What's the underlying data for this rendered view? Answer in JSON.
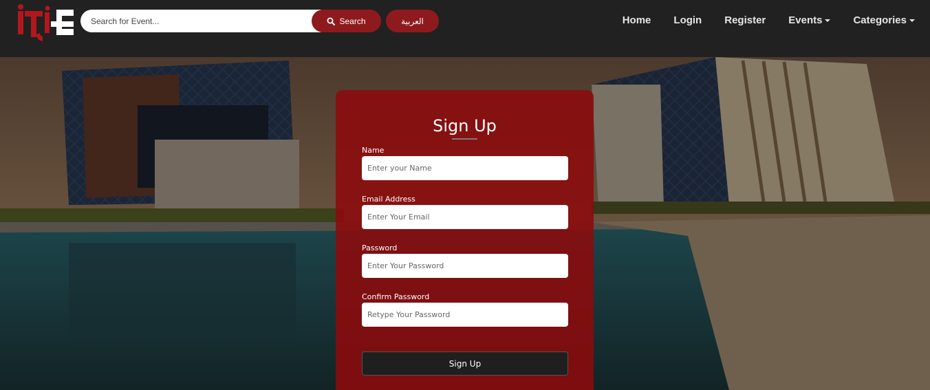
{
  "navbar": {
    "logo_text": "ITI E",
    "search": {
      "placeholder": "Search for Event...",
      "value": ""
    },
    "search_button": "Search",
    "language_button": "العربية",
    "links": [
      {
        "label": "Home",
        "dropdown": false
      },
      {
        "label": "Login",
        "dropdown": false
      },
      {
        "label": "Register",
        "dropdown": false
      },
      {
        "label": "Events",
        "dropdown": true
      },
      {
        "label": "Categories",
        "dropdown": true
      }
    ]
  },
  "form": {
    "title": "Sign Up",
    "fields": [
      {
        "label": "Name",
        "placeholder": "Enter your Name",
        "value": ""
      },
      {
        "label": "Email Address",
        "placeholder": "Enter Your Email",
        "value": ""
      },
      {
        "label": "Password",
        "placeholder": "Enter Your Password",
        "value": ""
      },
      {
        "label": "Confirm Password",
        "placeholder": "Retype Your Password",
        "value": ""
      }
    ],
    "submit_label": "Sign Up"
  },
  "colors": {
    "navbar_bg": "#212121",
    "accent_red": "#8e1a1e",
    "card_red": "#8c0a0c",
    "button_dark": "#1f1f1f"
  }
}
